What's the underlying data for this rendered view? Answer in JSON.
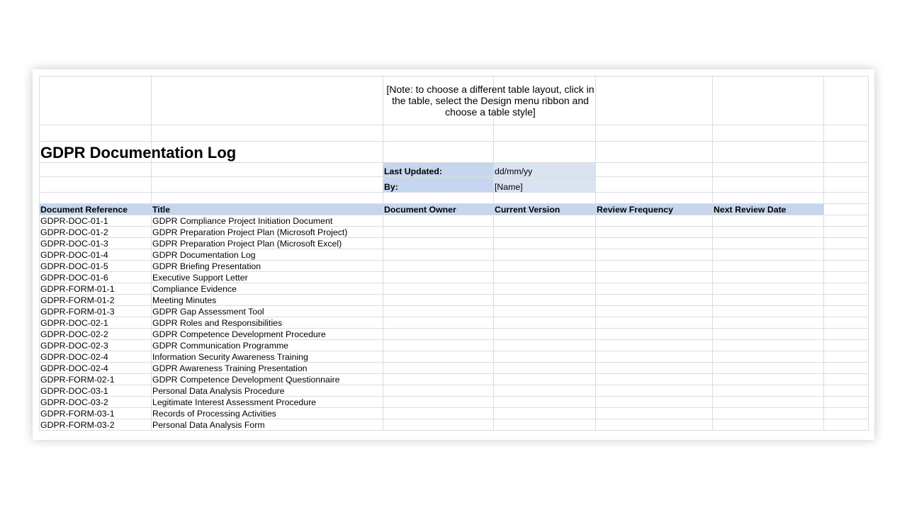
{
  "note": "[Note: to choose a different table layout,  click in the table, select the Design menu ribbon and choose a  table style]",
  "title": "GDPR Documentation Log",
  "meta": {
    "last_updated_label": "Last Updated:",
    "last_updated_value": "dd/mm/yy",
    "by_label": "By:",
    "by_value": "[Name]"
  },
  "headers": [
    "Document Reference",
    "Title",
    "Document Owner",
    "Current Version",
    "Review Frequency",
    "Next Review Date"
  ],
  "rows": [
    {
      "ref": "GDPR-DOC-01-1",
      "title": "GDPR Compliance Project Initiation Document"
    },
    {
      "ref": "GDPR-DOC-01-2",
      "title": "GDPR Preparation Project Plan (Microsoft Project)"
    },
    {
      "ref": "GDPR-DOC-01-3",
      "title": "GDPR Preparation Project Plan (Microsoft Excel)"
    },
    {
      "ref": "GDPR-DOC-01-4",
      "title": "GDPR Documentation Log"
    },
    {
      "ref": "GDPR-DOC-01-5",
      "title": "GDPR Briefing Presentation"
    },
    {
      "ref": "GDPR-DOC-01-6",
      "title": "Executive Support Letter"
    },
    {
      "ref": "GDPR-FORM-01-1",
      "title": "Compliance Evidence"
    },
    {
      "ref": "GDPR-FORM-01-2",
      "title": "Meeting Minutes"
    },
    {
      "ref": "GDPR-FORM-01-3",
      "title": "GDPR Gap Assessment Tool"
    },
    {
      "ref": "GDPR-DOC-02-1",
      "title": "GDPR Roles and Responsibilities"
    },
    {
      "ref": "GDPR-DOC-02-2",
      "title": "GDPR Competence Development Procedure"
    },
    {
      "ref": "GDPR-DOC-02-3",
      "title": "GDPR Communication Programme"
    },
    {
      "ref": "GDPR-DOC-02-4",
      "title": "Information Security Awareness Training"
    },
    {
      "ref": "GDPR-DOC-02-4",
      "title": "GDPR Awareness Training Presentation"
    },
    {
      "ref": "GDPR-FORM-02-1",
      "title": "GDPR Competence Development Questionnaire"
    },
    {
      "ref": "GDPR-DOC-03-1",
      "title": "Personal Data Analysis Procedure"
    },
    {
      "ref": "GDPR-DOC-03-2",
      "title": "Legitimate Interest Assessment Procedure"
    },
    {
      "ref": "GDPR-FORM-03-1",
      "title": "Records of Processing Activities"
    },
    {
      "ref": "GDPR-FORM-03-2",
      "title": "Personal Data Analysis Form"
    }
  ]
}
